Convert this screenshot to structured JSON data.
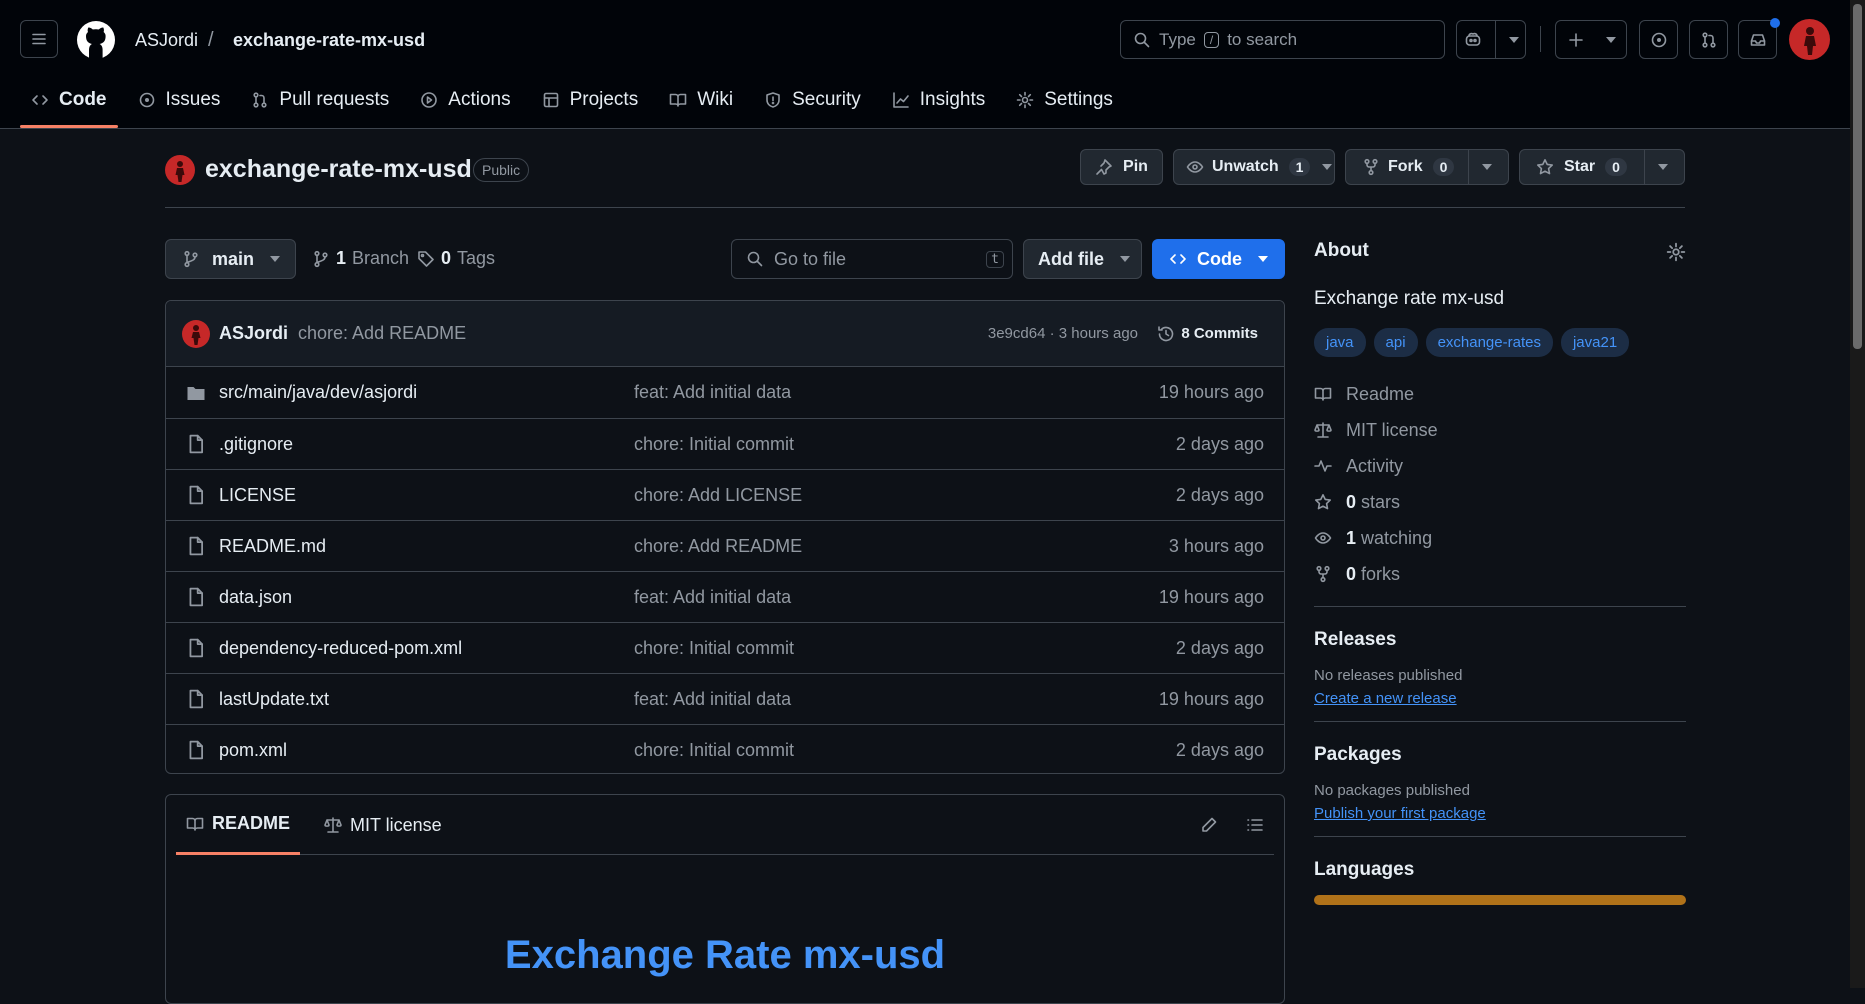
{
  "header": {
    "owner": "ASJordi",
    "separator": "/",
    "repo": "exchange-rate-mx-usd",
    "search_pre": "Type",
    "search_key": "/",
    "search_post": "to search"
  },
  "tabs": [
    {
      "label": "Code",
      "icon": "code-icon"
    },
    {
      "label": "Issues",
      "icon": "issue-icon"
    },
    {
      "label": "Pull requests",
      "icon": "pull-request-icon"
    },
    {
      "label": "Actions",
      "icon": "play-icon"
    },
    {
      "label": "Projects",
      "icon": "table-icon"
    },
    {
      "label": "Wiki",
      "icon": "book-icon"
    },
    {
      "label": "Security",
      "icon": "shield-icon"
    },
    {
      "label": "Insights",
      "icon": "graph-icon"
    },
    {
      "label": "Settings",
      "icon": "gear-icon"
    }
  ],
  "repo": {
    "name": "exchange-rate-mx-usd",
    "visibility": "Public",
    "pin": "Pin",
    "unwatch": "Unwatch",
    "watch_count": "1",
    "fork": "Fork",
    "fork_count": "0",
    "star": "Star",
    "star_count": "0"
  },
  "toolbar": {
    "branch": "main",
    "branches_count": "1",
    "branches_label": "Branch",
    "tags_count": "0",
    "tags_label": "Tags",
    "goto_placeholder": "Go to file",
    "goto_key": "t",
    "add_file": "Add file",
    "code": "Code"
  },
  "commit": {
    "author": "ASJordi",
    "message": "chore: Add README",
    "hash": "3e9cd64",
    "time": "· 3 hours ago",
    "commits": "8 Commits"
  },
  "files": [
    {
      "name": "src/main/java/dev/asjordi",
      "type": "folder",
      "message": "feat: Add initial data",
      "time": "19 hours ago"
    },
    {
      "name": ".gitignore",
      "type": "file",
      "message": "chore: Initial commit",
      "time": "2 days ago"
    },
    {
      "name": "LICENSE",
      "type": "file",
      "message": "chore: Add LICENSE",
      "time": "2 days ago"
    },
    {
      "name": "README.md",
      "type": "file",
      "message": "chore: Add README",
      "time": "3 hours ago"
    },
    {
      "name": "data.json",
      "type": "file",
      "message": "feat: Add initial data",
      "time": "19 hours ago"
    },
    {
      "name": "dependency-reduced-pom.xml",
      "type": "file",
      "message": "chore: Initial commit",
      "time": "2 days ago"
    },
    {
      "name": "lastUpdate.txt",
      "type": "file",
      "message": "feat: Add initial data",
      "time": "19 hours ago"
    },
    {
      "name": "pom.xml",
      "type": "file",
      "message": "chore: Initial commit",
      "time": "2 days ago"
    }
  ],
  "readme": {
    "tab1": "README",
    "tab2": "MIT license",
    "title": "Exchange Rate mx-usd"
  },
  "about": {
    "heading": "About",
    "description": "Exchange rate mx-usd",
    "topics": [
      "java",
      "api",
      "exchange-rates",
      "java21"
    ],
    "readme": "Readme",
    "license": "MIT license",
    "activity": "Activity",
    "stars_n": "0",
    "stars": "stars",
    "watching_n": "1",
    "watching": "watching",
    "forks_n": "0",
    "forks": "forks"
  },
  "releases": {
    "heading": "Releases",
    "none": "No releases published",
    "link": "Create a new release"
  },
  "packages": {
    "heading": "Packages",
    "none": "No packages published",
    "link": "Publish your first package"
  },
  "languages": {
    "heading": "Languages"
  },
  "colors": {
    "accent": "#f78166",
    "link": "#4493f8",
    "primary": "#1f6feb",
    "lang_bar": "#b07219"
  }
}
